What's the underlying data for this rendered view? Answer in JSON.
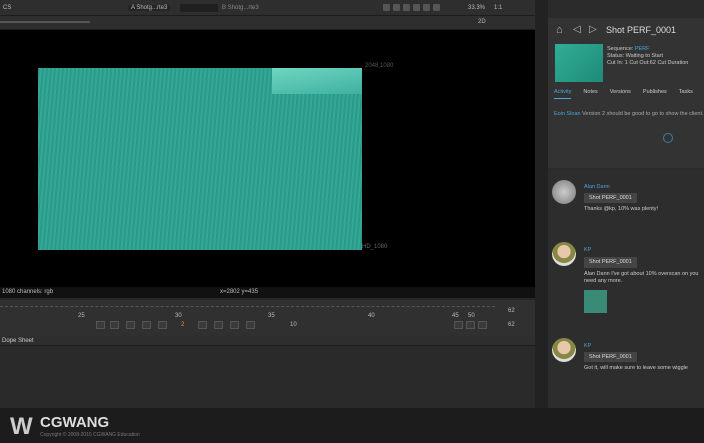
{
  "viewer": {
    "toolbar": {
      "layer": "CS",
      "input_a": "A Shotg...rte3",
      "input_b": "B Shotg...rte3",
      "zoom": "33.3%",
      "ratio": "1:1",
      "frame_field": "2D"
    },
    "format_top": "2048,1080",
    "format_bottom": "HD_1080",
    "info_left": "1080 channels: rgb",
    "info_center": "x=2802 y=435",
    "image_color": "#2fa08f"
  },
  "timeline": {
    "ticks": [
      "25",
      "30",
      "35",
      "40",
      "45",
      "50"
    ],
    "current_frame": "2",
    "end_frame": "62",
    "fps": "10",
    "frame_out": "62"
  },
  "dope_sheet": {
    "title": "Dope Sheet"
  },
  "watermark": {
    "brand": "CGWANG",
    "sub": "Copyright © 2008-2015 CGWANG Education"
  },
  "panel": {
    "title": "Shot PERF_0001",
    "sequence_label": "Sequence:",
    "sequence_value": "PERF",
    "status": "Status: Waiting to Start",
    "cut": "Cut In: 1 Cut Out:62 Cut Duration",
    "tabs": [
      "Activity",
      "Notes",
      "Versions",
      "Publishes",
      "Tasks"
    ],
    "activity_author": "Eoin Sloan",
    "activity_text": "Version 2 should be good to go to show the client.",
    "notes": [
      {
        "author": "Alan Dann",
        "shot": "Shot PERF_0001",
        "text": "Thanks @kp, 10% was plenty!"
      },
      {
        "author": "KP",
        "shot": "Shot PERF_0001",
        "text": "Alan Dann I've got about 10% overscan on you need any more."
      },
      {
        "author": "KP",
        "shot": "Shot PERF_0001",
        "text": "Got it, will make sure to leave some wiggle"
      }
    ],
    "accent": "#4fa3d9"
  }
}
